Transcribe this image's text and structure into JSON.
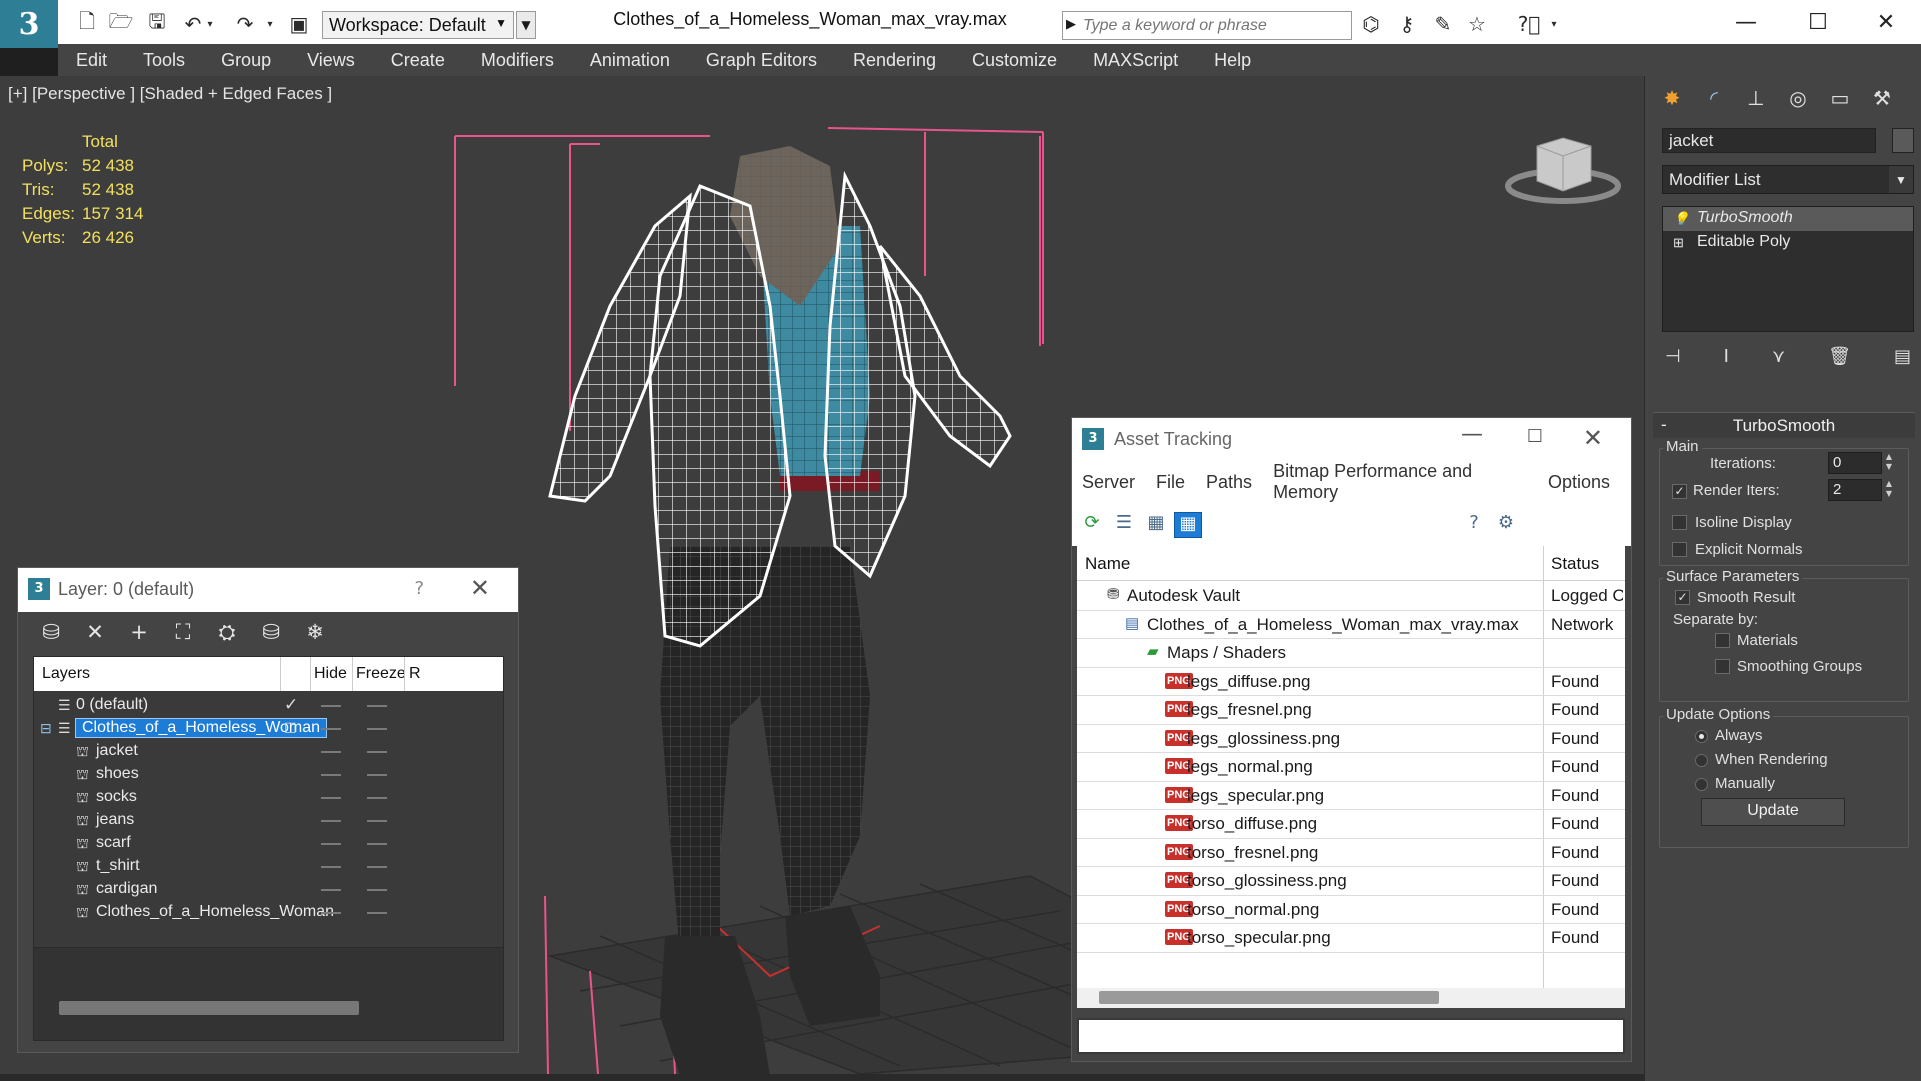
{
  "titlebar": {
    "workspace_label": "Workspace: Default",
    "file_title": "Clothes_of_a_Homeless_Woman_max_vray.max",
    "search_placeholder": "Type a keyword or phrase",
    "logo_icon": "3dsmax-logo-icon"
  },
  "menu": [
    "Edit",
    "Tools",
    "Group",
    "Views",
    "Create",
    "Modifiers",
    "Animation",
    "Graph Editors",
    "Rendering",
    "Customize",
    "MAXScript",
    "Help"
  ],
  "viewport": {
    "label": "[+] [Perspective ] [Shaded + Edged Faces ]",
    "stats": {
      "total_label": "Total",
      "rows": [
        {
          "key": "Polys:",
          "value": "52 438"
        },
        {
          "key": "Tris:",
          "value": "52 438"
        },
        {
          "key": "Edges:",
          "value": "157 314"
        },
        {
          "key": "Verts:",
          "value": "26 426"
        }
      ]
    },
    "stats_color": "#f2e05e",
    "bbox_color": "#e8548c"
  },
  "command_panel": {
    "object_name": "jacket",
    "modifier_list": "Modifier List",
    "stack": [
      "TurboSmooth",
      "Editable Poly"
    ],
    "rollout_title": "TurboSmooth",
    "main": {
      "label": "Main",
      "iterations_label": "Iterations:",
      "iterations_value": "0",
      "render_iters_label": "Render Iters:",
      "render_iters_value": "2",
      "isoline_label": "Isoline Display",
      "explicit_normals_label": "Explicit Normals"
    },
    "surface": {
      "label": "Surface Parameters",
      "smooth_result_label": "Smooth Result",
      "separate_by_label": "Separate by:",
      "materials_label": "Materials",
      "smoothing_groups_label": "Smoothing Groups"
    },
    "update": {
      "label": "Update Options",
      "always_label": "Always",
      "when_rendering_label": "When Rendering",
      "manually_label": "Manually",
      "button_label": "Update"
    }
  },
  "layer_dialog": {
    "title": "Layer: 0 (default)",
    "help": "?",
    "columns": {
      "layers": "Layers",
      "hide": "Hide",
      "freeze": "Freeze",
      "render": "R"
    },
    "rows": [
      {
        "name": "0 (default)",
        "level": 0
      },
      {
        "name": "Clothes_of_a_Homeless_Woman",
        "level": 0
      },
      {
        "name": "jacket",
        "level": 1
      },
      {
        "name": "shoes",
        "level": 1
      },
      {
        "name": "socks",
        "level": 1
      },
      {
        "name": "jeans",
        "level": 1
      },
      {
        "name": "scarf",
        "level": 1
      },
      {
        "name": "t_shirt",
        "level": 1
      },
      {
        "name": "cardigan",
        "level": 1
      },
      {
        "name": "Clothes_of_a_Homeless_Woman",
        "level": 1
      }
    ]
  },
  "asset_dialog": {
    "title": "Asset Tracking",
    "menu": [
      "Server",
      "File",
      "Paths",
      "Bitmap Performance and Memory",
      "Options"
    ],
    "columns": {
      "name": "Name",
      "status": "Status"
    },
    "rows": [
      {
        "name": "Autodesk Vault",
        "status": "Logged O",
        "icon": "vault-icon"
      },
      {
        "name": "Clothes_of_a_Homeless_Woman_max_vray.max",
        "status": "Network",
        "icon": "max-file-icon"
      },
      {
        "name": "Maps / Shaders",
        "status": "",
        "icon": "maps-folder-icon"
      },
      {
        "name": "legs_diffuse.png",
        "status": "Found",
        "icon": "png-icon"
      },
      {
        "name": "legs_fresnel.png",
        "status": "Found",
        "icon": "png-icon"
      },
      {
        "name": "legs_glossiness.png",
        "status": "Found",
        "icon": "png-icon"
      },
      {
        "name": "legs_normal.png",
        "status": "Found",
        "icon": "png-icon"
      },
      {
        "name": "legs_specular.png",
        "status": "Found",
        "icon": "png-icon"
      },
      {
        "name": "torso_diffuse.png",
        "status": "Found",
        "icon": "png-icon"
      },
      {
        "name": "torso_fresnel.png",
        "status": "Found",
        "icon": "png-icon"
      },
      {
        "name": "torso_glossiness.png",
        "status": "Found",
        "icon": "png-icon"
      },
      {
        "name": "torso_normal.png",
        "status": "Found",
        "icon": "png-icon"
      },
      {
        "name": "torso_specular.png",
        "status": "Found",
        "icon": "png-icon"
      }
    ],
    "png_badge": "PNG"
  }
}
